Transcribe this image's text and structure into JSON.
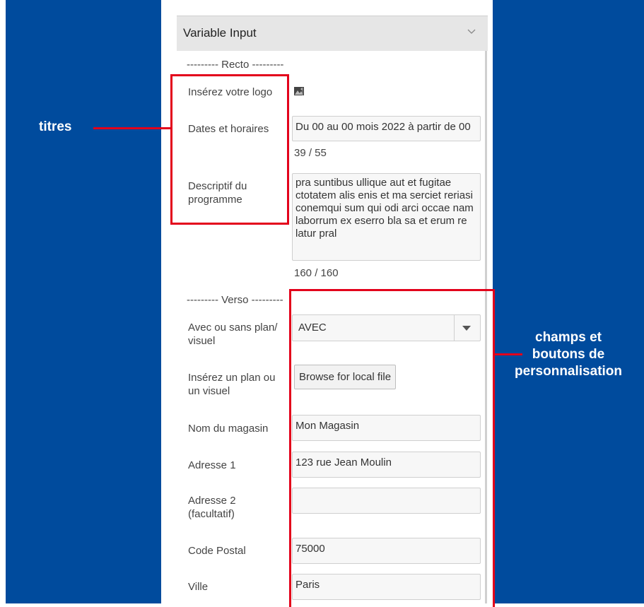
{
  "annotations": {
    "titles": "titres",
    "fields_line1": "champs et",
    "fields_line2": "boutons de",
    "fields_line3": "personnalisation"
  },
  "panel": {
    "title": "Variable Input",
    "recto_separator": "--------- Recto ---------",
    "verso_separator": "--------- Verso ---------"
  },
  "recto": {
    "logo_label": "Insérez votre logo",
    "dates_label": "Dates et horaires",
    "dates_value": "Du 00 au 00 mois 2022 à partir de 00",
    "dates_counter": "39 / 55",
    "desc_label": "Descriptif du programme",
    "desc_value": "pra suntibus ullique aut et fugitae ctotatem alis enis et ma serciet reriasi conemqui sum qui odi arci occae nam laborrum ex eserro bla sa et erum re latur pral",
    "desc_counter": "160 / 160"
  },
  "verso": {
    "plan_label": "Avec ou sans plan/ visuel",
    "plan_value": "AVEC",
    "upload_label": "Insérez un plan ou un visuel",
    "upload_button": "Browse for local file",
    "store_label": "Nom du magasin",
    "store_value": "Mon Magasin",
    "address1_label": "Adresse 1",
    "address1_value": "123 rue Jean Moulin",
    "address2_label": "Adresse 2 (facultatif)",
    "address2_value": "",
    "zip_label": "Code Postal",
    "zip_value": "75000",
    "city_label": "Ville",
    "city_value": "Paris"
  },
  "colors": {
    "brand_blue": "#004b9d",
    "annotation_red": "#e3001b"
  }
}
